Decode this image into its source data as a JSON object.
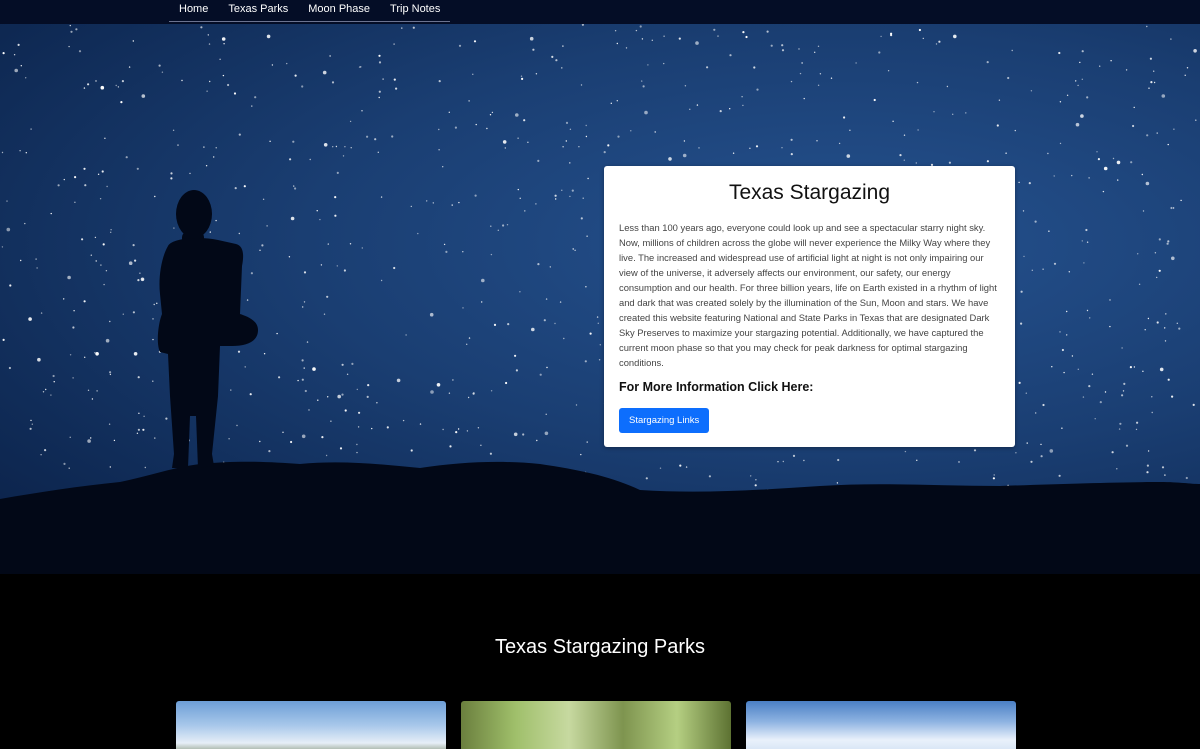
{
  "nav": {
    "items": [
      {
        "label": "Home"
      },
      {
        "label": "Texas Parks"
      },
      {
        "label": "Moon Phase"
      },
      {
        "label": "Trip Notes"
      }
    ]
  },
  "hero": {
    "card": {
      "title": "Texas Stargazing",
      "body": "Less than 100 years ago, everyone could look up and see a spectacular starry night sky. Now, millions of children across the globe will never experience the Milky Way where they live. The increased and widespread use of artificial light at night is not only impairing our view of the universe, it adversely affects our environment, our safety, our energy consumption and our health. For three billion years, life on Earth existed in a rhythm of light and dark that was created solely by the illumination of the Sun, Moon and stars. We have created this website featuring National and State Parks in Texas that are designated Dark Sky Preserves to maximize your stargazing potential. Additionally, we have captured the current moon phase so that you may check for peak darkness for optimal stargazing conditions.",
      "subtitle": "For More Information Click Here:",
      "button_label": "Stargazing Links"
    }
  },
  "parks": {
    "heading": "Texas Stargazing Parks"
  },
  "colors": {
    "navbar": "#040d26",
    "sky": "#1a3e72",
    "button": "#0d6efd"
  }
}
